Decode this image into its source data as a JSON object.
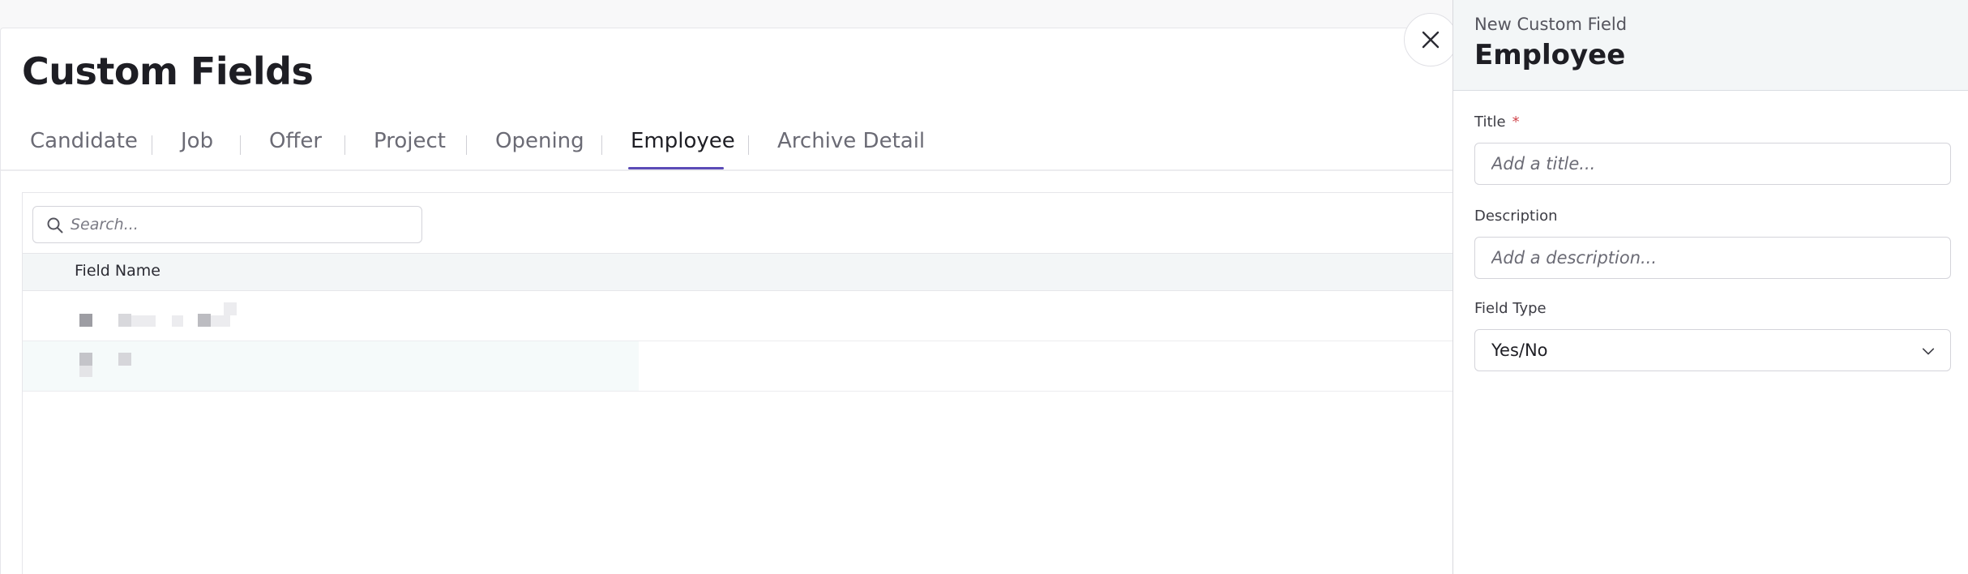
{
  "page": {
    "title": "Custom Fields"
  },
  "tabs": [
    {
      "label": "Candidate",
      "active": false
    },
    {
      "label": "Job",
      "active": false
    },
    {
      "label": "Offer",
      "active": false
    },
    {
      "label": "Project",
      "active": false
    },
    {
      "label": "Opening",
      "active": false
    },
    {
      "label": "Employee",
      "active": true
    },
    {
      "label": "Archive Detail",
      "active": false
    }
  ],
  "search": {
    "placeholder": "Search...",
    "value": ""
  },
  "table": {
    "columns": [
      "Field Name"
    ]
  },
  "close_button": {
    "icon": "close-icon"
  },
  "panel": {
    "subtitle": "New Custom Field",
    "title": "Employee",
    "fields": {
      "title": {
        "label": "Title",
        "required_marker": "*",
        "placeholder": "Add a title...",
        "value": ""
      },
      "description": {
        "label": "Description",
        "placeholder": "Add a description...",
        "value": ""
      },
      "field_type": {
        "label": "Field Type",
        "value": "Yes/No"
      }
    }
  },
  "colors": {
    "accent": "#5b4bb7",
    "required": "#d0454c",
    "header_bg": "#f3f6f7"
  }
}
